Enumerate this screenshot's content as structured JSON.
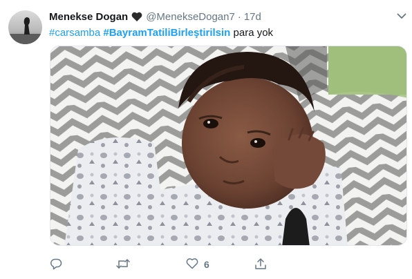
{
  "tweet": {
    "display_name": "Menekse Dogan",
    "handle": "@MenekseDogan7",
    "separator": "·",
    "time": "17d",
    "text": {
      "hashtag_1": "#carsamba",
      "hashtag_2": "#BayramTatiliBirleştirilsin",
      "body": "para yok"
    },
    "actions": {
      "reply_count": "",
      "retweet_count": "",
      "like_count": "6"
    }
  },
  "icons": {
    "heart": "black-heart-icon",
    "caret": "chevron-down-icon",
    "reply": "reply-icon",
    "retweet": "retweet-icon",
    "like": "like-icon",
    "share": "share-icon"
  },
  "colors": {
    "accent": "#1da1f2",
    "text": "#14171a",
    "secondary": "#657786"
  }
}
